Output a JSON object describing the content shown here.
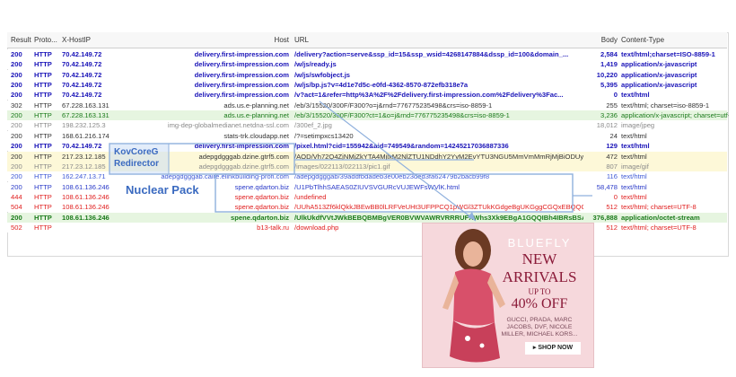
{
  "header": {
    "result": "Result",
    "protocol": "Proto...",
    "xhostip": "X-HostIP",
    "host": "Host",
    "url": "URL",
    "body": "Body",
    "content_type": "Content-Type"
  },
  "rows": [
    {
      "result": "200",
      "protocol": "HTTP",
      "ip": "70.42.149.72",
      "host": "delivery.first-impression.com",
      "url": "/delivery?action=serve&ssp_id=15&ssp_wsid=4268147884&dssp_id=100&domain_...",
      "body": "2,584",
      "ct": "text/html;charset=ISO-8859-1",
      "style": "blue"
    },
    {
      "result": "200",
      "protocol": "HTTP",
      "ip": "70.42.149.72",
      "host": "delivery.first-impression.com",
      "url": "/w/js/ready.js",
      "body": "1,419",
      "ct": "application/x-javascript",
      "style": "blue"
    },
    {
      "result": "200",
      "protocol": "HTTP",
      "ip": "70.42.149.72",
      "host": "delivery.first-impression.com",
      "url": "/w/js/swfobject.js",
      "body": "10,220",
      "ct": "application/x-javascript",
      "style": "blue"
    },
    {
      "result": "200",
      "protocol": "HTTP",
      "ip": "70.42.149.72",
      "host": "delivery.first-impression.com",
      "url": "/w/js/bp.js?v=4d1e7d5c-e0fd-4362-8570-872efb318e7a",
      "body": "5,395",
      "ct": "application/x-javascript",
      "style": "blue"
    },
    {
      "result": "200",
      "protocol": "HTTP",
      "ip": "70.42.149.72",
      "host": "delivery.first-impression.com",
      "url": "/v?act=1&refer=http%3A%2F%2Fdelivery.first-impression.com%2Fdelivery%3Fac...",
      "body": "0",
      "ct": "text/html",
      "style": "blue"
    },
    {
      "result": "302",
      "protocol": "HTTP",
      "ip": "67.228.163.131",
      "host": "ads.us.e-planning.net",
      "url": "/eb/3/15520/300F/F300?o=j&rnd=776775235498&crs=iso-8859-1",
      "body": "255",
      "ct": "text/html; charset=iso-8859-1",
      "style": "black"
    },
    {
      "result": "200",
      "protocol": "HTTP",
      "ip": "67.228.163.131",
      "host": "ads.us.e-planning.net",
      "url": "/eb/3/15520/300F/F300?ct=1&o=j&rnd=776775235498&crs=iso-8859-1",
      "body": "3,236",
      "ct": "application/x-javascript; charset=utf-8",
      "style": "green"
    },
    {
      "result": "200",
      "protocol": "HTTP",
      "ip": "198.232.125.3",
      "host": "img-dep-globalmedianet.netdna-ssl.com",
      "url": "/300ef_2.jpg",
      "body": "18,012",
      "ct": "image/jpeg",
      "style": "gray"
    },
    {
      "result": "200",
      "protocol": "HTTP",
      "ip": "168.61.216.174",
      "host": "stats-trk.cloudapp.net",
      "url": "/?=setimpxcs13420",
      "body": "24",
      "ct": "text/html",
      "style": "black"
    },
    {
      "result": "200",
      "protocol": "HTTP",
      "ip": "70.42.149.72",
      "host": "delivery.first-impression.com",
      "url": "/pixel.html?cid=155942&aid=749549&random=14245217036887336",
      "body": "129",
      "ct": "text/html",
      "style": "blue"
    },
    {
      "result": "200",
      "protocol": "HTTP",
      "ip": "217.23.12.185",
      "host": "adepgdgggab.dzine.gtrf5.com",
      "url": "/AOD/Vh72Q4ZjNMjZkYTA4MjlxM2NlZTU1NDdhY2YyM2EvYTU3NGU5MmVmMmRjMjBiODUyNDhhODM2...",
      "body": "472",
      "ct": "text/html",
      "style": "black"
    },
    {
      "result": "200",
      "protocol": "HTTP",
      "ip": "217.23.12.185",
      "host": "adepgdgggab.dzine.gtrf5.com",
      "url": "/images/022113/022113/pic1.gif",
      "body": "807",
      "ct": "image/gif",
      "style": "gray"
    },
    {
      "result": "200",
      "protocol": "HTTP",
      "ip": "162.247.13.71",
      "host": "adepgdgggab.caire.elinkbuilding-profi.com",
      "url": "/adepgdgggab/39addfbdadeb3e00eb23ded3fa62479b2bacb99f8",
      "body": "116",
      "ct": "text/html",
      "style": "lblue"
    },
    {
      "result": "200",
      "protocol": "HTTP",
      "ip": "108.61.136.246",
      "host": "spene.qdarton.biz",
      "url": "/U1PbTlhhSAEAS0ZIUVSVGURcVUJEWFsWVlK.html",
      "body": "58,478",
      "ct": "text/html",
      "style": "blue2"
    },
    {
      "result": "444",
      "protocol": "HTTP",
      "ip": "108.61.136.246",
      "host": "spene.qdarton.biz",
      "url": "/undefined",
      "body": "0",
      "ct": "text/html",
      "style": "red"
    },
    {
      "result": "504",
      "protocol": "HTTP",
      "ip": "108.61.136.246",
      "host": "spene.qdarton.biz",
      "url": "/UUhA513Zf6klQkkJBEwBB0lLRFVeUHt3UFPPCQ1pWGl3ZTUkKGdgeBgUKGggCGQxEBQQCAwAKBQcB...",
      "body": "512",
      "ct": "text/html; charset=UTF-8",
      "style": "red"
    },
    {
      "result": "200",
      "protocol": "HTTP",
      "ip": "108.61.136.246",
      "host": "spene.qdarton.biz",
      "url": "/UlkUkdfVVtJWkBEBQBMBgVER0BVWVAWRVRRRUFXWhs3Xk9EBgA1GQQIBh4IBRsBSAE...",
      "body": "376,888",
      "ct": "application/octet-stream",
      "style": "green-bold"
    },
    {
      "result": "502",
      "protocol": "HTTP",
      "ip": "",
      "host": "b13-talk.ru",
      "url": "/download.php",
      "body": "512",
      "ct": "text/html; charset=UTF-8",
      "style": "red"
    }
  ],
  "annotations": {
    "redirector_line1": "KovCoreG",
    "redirector_line2": "Redirector",
    "exploit_kit": "Nuclear Pack"
  },
  "ad": {
    "brand": "BLUEFLY",
    "headline1": "NEW",
    "headline2": "ARRIVALS",
    "upto": "UP TO",
    "discount": "40% OFF",
    "brands": "GUCCI, PRADA, MARC JACOBS, DVF, NICOLE MILLER, MICHAEL KORS...",
    "cta": "▸ SHOP NOW"
  },
  "colors": {
    "accent_annotation": "#3a6ac0",
    "row_highlight_yellow": "#fdf8d8",
    "row_highlight_green": "#e6f5e0"
  }
}
